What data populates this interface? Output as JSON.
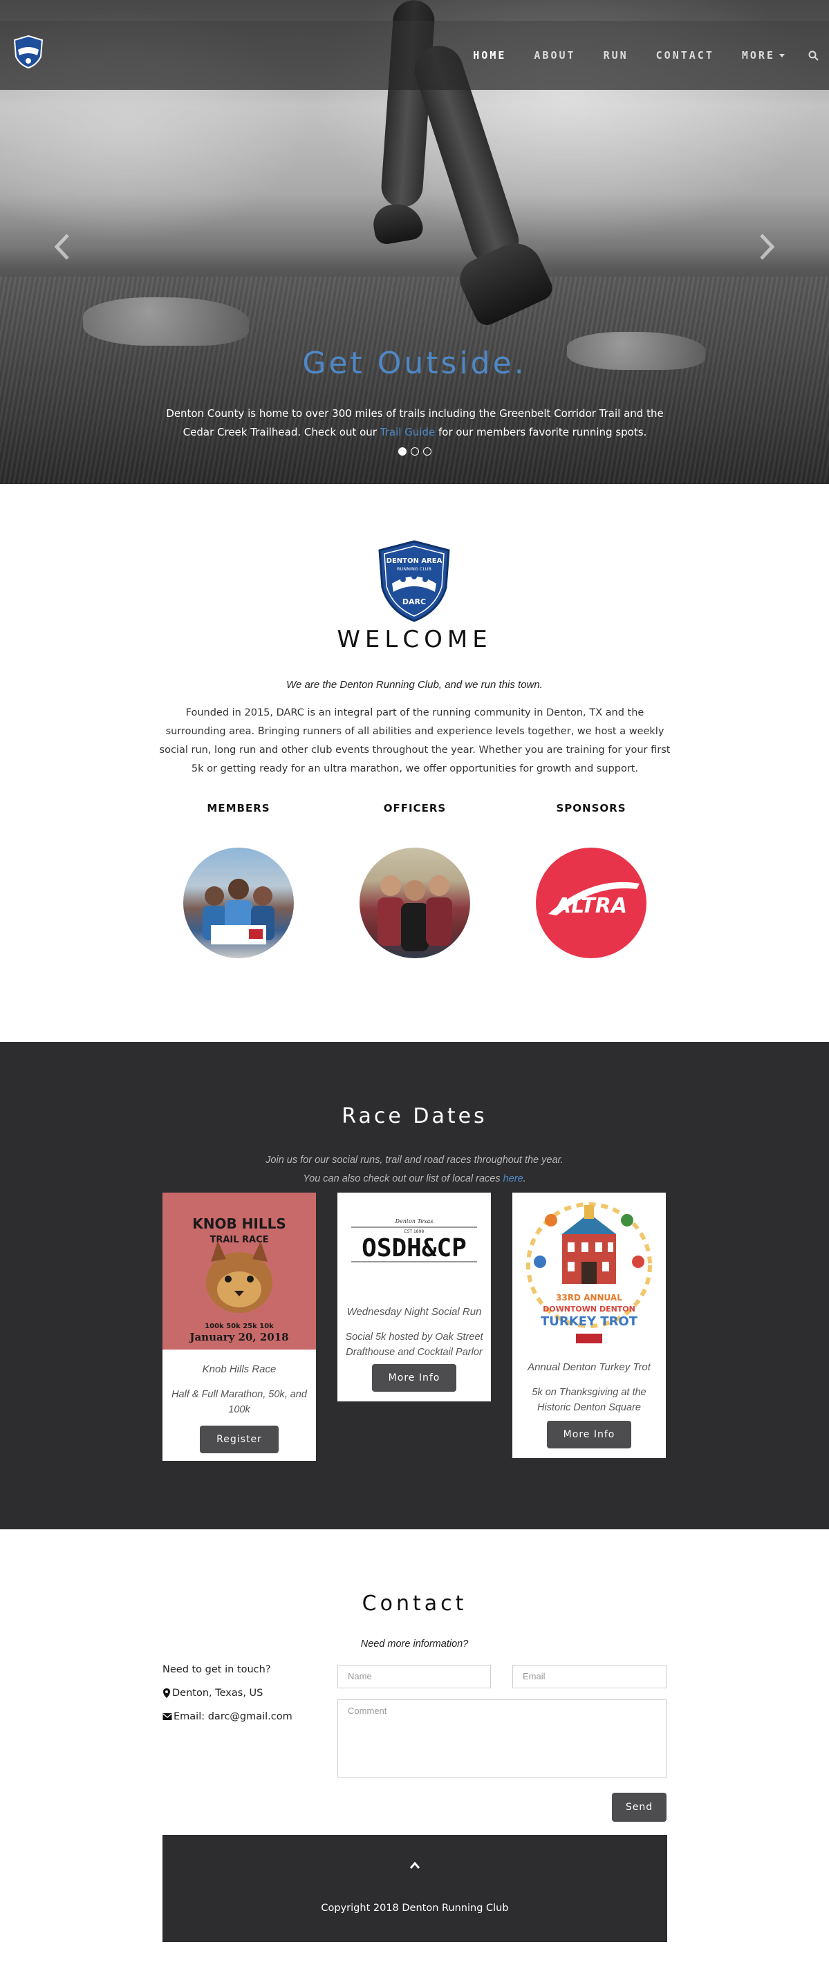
{
  "nav": {
    "items": [
      {
        "label": "HOME"
      },
      {
        "label": "ABOUT"
      },
      {
        "label": "RUN"
      },
      {
        "label": "CONTACT"
      },
      {
        "label": "MORE"
      }
    ]
  },
  "hero": {
    "heading": "Get Outside.",
    "caption_before": "Denton County is home to over 300 miles of trails including the Greenbelt Corridor Trail and the Cedar Creek Trailhead. Check out our ",
    "caption_link": "Trail Guide",
    "caption_after": " for our members favorite running spots.",
    "slides": 3,
    "active_slide": 1
  },
  "welcome": {
    "crest_text_top": "DENTON AREA",
    "crest_text_sub": "RUNNING CLUB",
    "crest_text_bottom": "DARC",
    "title": "WELCOME",
    "tagline": "We are the Denton Running Club, and we run this town.",
    "body": "Founded in 2015, DARC is an integral part of the running community in Denton, TX and the surrounding area. Bringing runners of all abilities and experience levels together, we host a weekly social run, long run and other club events throughout the year. Whether you are training for your first 5k or getting ready for an ultra marathon, we offer opportunities for growth and support.",
    "groups": [
      {
        "title": "MEMBERS"
      },
      {
        "title": "OFFICERS"
      },
      {
        "title": "SPONSORS",
        "logo_text": "ALTRA"
      }
    ]
  },
  "races": {
    "title": "Race Dates",
    "sub_line1": "Join us for our social runs, trail and road races throughout the year.",
    "sub_line2_before": "You can also check out our list of local races ",
    "sub_line2_link": "here",
    "sub_line2_after": ".",
    "cards": [
      {
        "title": "Knob Hills Race",
        "desc": "Half & Full Marathon, 50k, and 100k",
        "button": "Register",
        "img_line1": "KNOB HILLS",
        "img_line2": "TRAIL RACE",
        "img_line3": "100k 50k 25k 10k",
        "img_line4": "January 20, 2018"
      },
      {
        "title": "Wednesday Night Social Run",
        "desc": "Social 5k hosted by Oak Street Drafthouse and Cocktail Parlor",
        "button": "More Info",
        "img_line1": "Denton Texas",
        "img_line2": "EST 1898",
        "img_line3": "OSDH&CP"
      },
      {
        "title": "Annual Denton Turkey Trot",
        "desc": "5k on Thanksgiving at the Historic Denton Square",
        "button": "More Info",
        "img_line1": "33RD ANNUAL",
        "img_line2": "DOWNTOWN DENTON",
        "img_line3": "TURKEY TROT"
      }
    ]
  },
  "contact": {
    "title": "Contact",
    "sub": "Need more information?",
    "touch": "Need to get in touch?",
    "location": "Denton, Texas, US",
    "email": "Email: darc@gmail.com",
    "name_placeholder": "Name",
    "email_placeholder": "Email",
    "comment_placeholder": "Comment",
    "send": "Send"
  },
  "footer": {
    "copyright": "Copyright 2018 Denton Running Club"
  },
  "colors": {
    "accent": "#4f88c6",
    "dark": "#2d2d2f",
    "button": "#4d4d4f",
    "altra_red": "#e8344a"
  }
}
